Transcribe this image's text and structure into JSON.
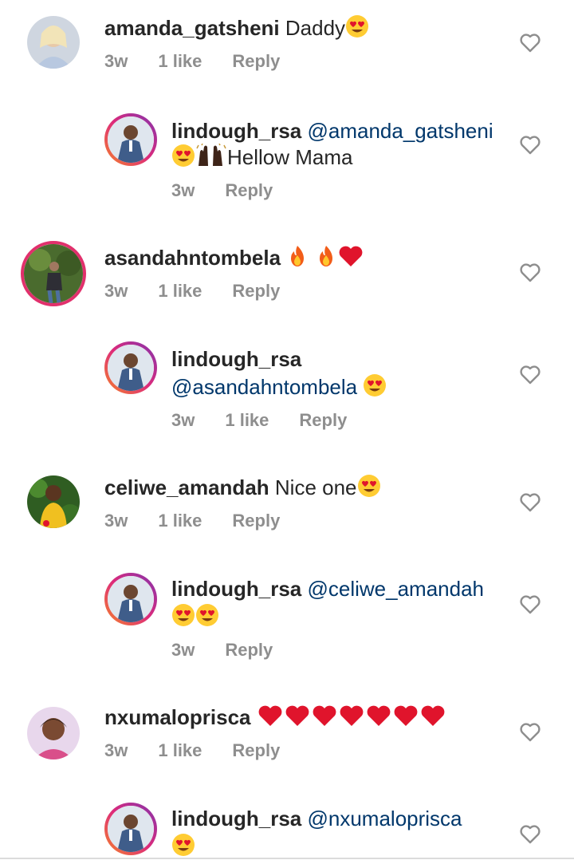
{
  "comments": [
    {
      "user": "amanda_gatsheni",
      "text": "Daddy",
      "time": "3w",
      "likes": "1 like",
      "reply": "Reply"
    },
    {
      "user": "lindough_rsa",
      "mention": "@amanda_gatsheni",
      "text": "Hellow Mama",
      "time": "3w",
      "reply": "Reply"
    },
    {
      "user": "asandahntombela",
      "time": "3w",
      "likes": "1 like",
      "reply": "Reply"
    },
    {
      "user": "lindough_rsa",
      "mention": "@asandahntombela",
      "time": "3w",
      "likes": "1 like",
      "reply": "Reply"
    },
    {
      "user": "celiwe_amandah",
      "text": "Nice one",
      "time": "3w",
      "likes": "1 like",
      "reply": "Reply"
    },
    {
      "user": "lindough_rsa",
      "mention": "@celiwe_amandah",
      "time": "3w",
      "reply": "Reply"
    },
    {
      "user": "nxumaloprisca",
      "time": "3w",
      "likes": "1 like",
      "reply": "Reply"
    },
    {
      "user": "lindough_rsa",
      "mention": "@nxumaloprisca"
    }
  ],
  "icons": {
    "like": "heart-outline-icon",
    "emoji_love": "heart-eyes-emoji",
    "emoji_fire": "fire-emoji",
    "emoji_heart": "red-heart-emoji",
    "emoji_hands": "raised-hands-emoji"
  },
  "colors": {
    "username": "#262626",
    "mention": "#00376b",
    "meta": "#8e8e8e",
    "heart_emoji": "#e0142c",
    "story_ring": "#e1306c"
  }
}
